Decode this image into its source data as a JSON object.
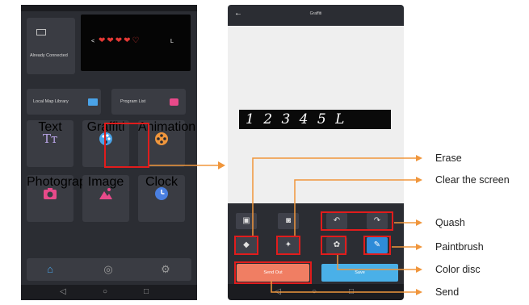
{
  "home_screen": {
    "connection_label": "Already Connected",
    "led_preview": {
      "left_arrow": "<",
      "right_text": "L"
    },
    "local_map_library_label": "Local Map Library",
    "program_list_label": "Program List",
    "tiles": [
      {
        "label": "Text",
        "glyph": "Tт"
      },
      {
        "label": "Graffiti"
      },
      {
        "label": "Animation"
      },
      {
        "label": "Photograph"
      },
      {
        "label": "Image"
      },
      {
        "label": "Clock"
      }
    ]
  },
  "graffiti_screen": {
    "back_glyph": "←",
    "title": "Graffiti",
    "canvas_text": "1 2 3 4 5 L",
    "send_label": "Send Out",
    "save_label": "Save"
  },
  "annotations": {
    "erase": "Erase",
    "clear_screen": "Clear the screen",
    "quash": "Quash",
    "paintbrush": "Paintbrush",
    "color_disc": "Color disc",
    "send": "Send"
  },
  "colors": {
    "highlight": "#e11c1c",
    "callout_arrow": "#f0963c",
    "app_background": "#2b2d33",
    "primary_blue": "#2e8bd8",
    "send_button": "#f07e63"
  }
}
